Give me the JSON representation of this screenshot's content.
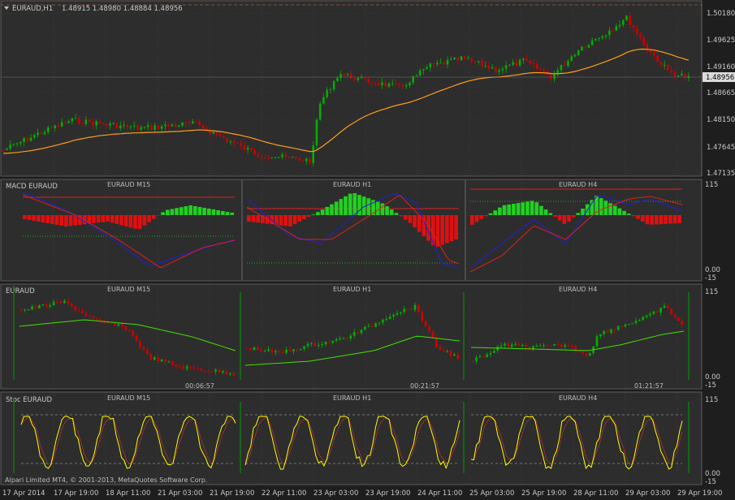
{
  "header": {
    "symbol": "EURAUD,H1",
    "ohlc": "1.48915 1.48980 1.48884 1.48956"
  },
  "colors": {
    "bg": "#2d2d2d",
    "grid": "#3c3c3c",
    "bull": "#00b000",
    "bear": "#d00000",
    "ma_main": "#ff9d1a",
    "ma_panel": "#44e000",
    "macd_main": "#2020e0",
    "macd_signal": "#e02020",
    "hist_pos": "#22d022",
    "hist_neg": "#e01010",
    "stoch_main": "#ffff00",
    "stoch_signal": "#e03030"
  },
  "main_chart": {
    "price_labels": [
      "1.50180",
      "1.49625",
      "1.49160",
      "1.48665",
      "1.48150",
      "1.47645",
      "1.47135"
    ],
    "current_price": "1.48956"
  },
  "panels": {
    "macd": {
      "title": "MACD EURAUD",
      "subcharts": [
        "EURAUD M15",
        "EURAUD H1",
        "EURAUD H4"
      ],
      "scale": [
        "115",
        "0.00",
        "-15"
      ]
    },
    "price": {
      "title": "EURAUD",
      "subcharts": [
        "EURAUD M15",
        "EURAUD H1",
        "EURAUD H4"
      ],
      "timers": [
        "00:06:57",
        "00:21:57",
        "01:21:57"
      ],
      "scale": [
        "115",
        "0.00",
        "-15"
      ]
    },
    "stoch": {
      "title": "Stoc EURAUD",
      "subcharts": [
        "EURAUD M15",
        "EURAUD H1",
        "EURAUD H4"
      ],
      "scale": [
        "115",
        "0.00",
        "-15"
      ]
    }
  },
  "copyright": "Alpari Limited MT4, © 2001-2013, MetaQuotes Software Corp.",
  "time_axis": [
    "17 Apr 2014",
    "17 Apr 19:00",
    "18 Apr 11:00",
    "21 Apr 03:00",
    "21 Apr 19:00",
    "22 Apr 11:00",
    "23 Apr 03:00",
    "23 Apr 19:00",
    "24 Apr 11:00",
    "25 Apr 03:00",
    "25 Apr 19:00",
    "28 Apr 11:00",
    "29 Apr 03:00",
    "29 Apr 19:00"
  ]
}
